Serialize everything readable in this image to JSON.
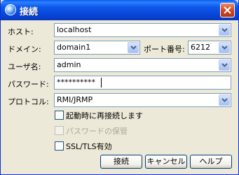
{
  "window": {
    "title": "接続"
  },
  "form": {
    "host": {
      "label": "ホスト:",
      "value": "localhost"
    },
    "domain": {
      "label": "ドメイン:",
      "value": "domain1"
    },
    "port": {
      "label": "ポート番号:",
      "value": "6212"
    },
    "user": {
      "label": "ユーザ名:",
      "value": "admin"
    },
    "password": {
      "label": "パスワード:",
      "value": "**********"
    },
    "protocol": {
      "label": "プロトコル:",
      "value": "RMI/JRMP"
    }
  },
  "options": {
    "reconnect": {
      "label": "起動時に再接続します",
      "checked": false,
      "enabled": true
    },
    "save_password": {
      "label": "パスワードの保管",
      "checked": false,
      "enabled": false
    },
    "ssl": {
      "label": "SSL/TLS有効",
      "checked": false,
      "enabled": true
    }
  },
  "buttons": {
    "connect": "接続",
    "cancel": "キャンセル",
    "help": "ヘルプ"
  },
  "icons": {
    "app": "connection-globe-icon",
    "close": "close-icon",
    "dropdown": "chevron-down-icon"
  },
  "colors": {
    "titlebar": "#0847d8",
    "close_button": "#d0451f",
    "dialog_bg": "#ece9d8",
    "field_border": "#7f9db9"
  }
}
